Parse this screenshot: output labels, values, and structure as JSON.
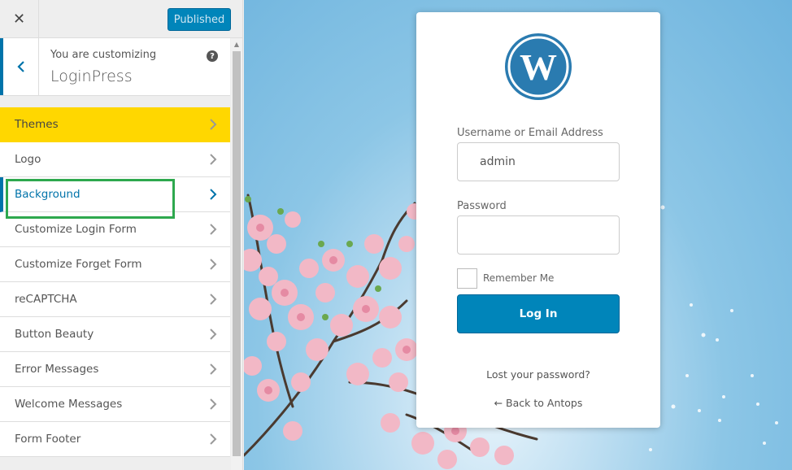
{
  "topbar": {
    "close_icon": "close-icon",
    "publish_label": "Published"
  },
  "info": {
    "subtitle": "You are customizing",
    "title": "LoginPress",
    "help_icon": "?"
  },
  "menu": {
    "items": [
      {
        "label": "Themes"
      },
      {
        "label": "Logo"
      },
      {
        "label": "Background"
      },
      {
        "label": "Customize Login Form"
      },
      {
        "label": "Customize Forget Form"
      },
      {
        "label": "reCAPTCHA"
      },
      {
        "label": "Button Beauty"
      },
      {
        "label": "Error Messages"
      },
      {
        "label": "Welcome Messages"
      },
      {
        "label": "Form Footer"
      }
    ]
  },
  "login": {
    "username_label": "Username or Email Address",
    "username_value": "admin",
    "password_label": "Password",
    "password_value": "",
    "remember_label": "Remember Me",
    "login_button": "Log In",
    "lost_password": "Lost your password?",
    "back_link": "← Back to Antops"
  },
  "colors": {
    "accent": "#0085ba",
    "active_item": "#ffd700",
    "highlight": "#2ea84e"
  }
}
